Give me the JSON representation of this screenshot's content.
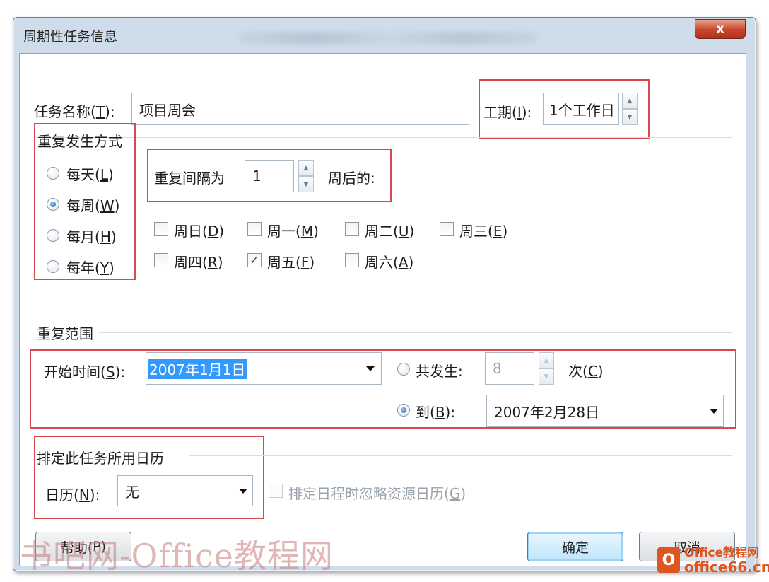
{
  "window": {
    "title": "周期性任务信息",
    "close_label": "x"
  },
  "task": {
    "name_label": "任务名称(T):",
    "name_label_main": "任务名称(",
    "name_label_key": "T",
    "name_label_end": "):",
    "name_value": "项目周会",
    "duration_label_main": "工期(",
    "duration_label_key": "I",
    "duration_label_end": "):",
    "duration_value": "1个工作日"
  },
  "recurrence": {
    "group_title": "重复发生方式",
    "options": [
      {
        "main": "每天(",
        "key": "L",
        "end": ")",
        "selected": false
      },
      {
        "main": "每周(",
        "key": "W",
        "end": ")",
        "selected": true
      },
      {
        "main": "每月(",
        "key": "H",
        "end": ")",
        "selected": false
      },
      {
        "main": "每年(",
        "key": "Y",
        "end": ")",
        "selected": false
      }
    ],
    "interval_label": "重复间隔为",
    "interval_value": "1",
    "interval_suffix": "周后的:",
    "days": [
      {
        "main": "周日(",
        "key": "D",
        "end": ")",
        "checked": false
      },
      {
        "main": "周一(",
        "key": "M",
        "end": ")",
        "checked": false
      },
      {
        "main": "周二(",
        "key": "U",
        "end": ")",
        "checked": false
      },
      {
        "main": "周三(",
        "key": "E",
        "end": ")",
        "checked": false
      },
      {
        "main": "周四(",
        "key": "R",
        "end": ")",
        "checked": false
      },
      {
        "main": "周五(",
        "key": "F",
        "end": ")",
        "checked": true
      },
      {
        "main": "周六(",
        "key": "A",
        "end": ")",
        "checked": false
      }
    ]
  },
  "range": {
    "group_title": "重复范围",
    "start_label_main": "开始时间(",
    "start_label_key": "S",
    "start_label_end": "):",
    "start_value": "2007年1月1日",
    "occur_label_main": "共发生:",
    "occur_value": "8",
    "occur_suffix_main": "次(",
    "occur_suffix_key": "C",
    "occur_suffix_end": ")",
    "occur_selected": false,
    "end_label_main": "到(",
    "end_label_key": "B",
    "end_label_end": "):",
    "end_selected": true,
    "end_value": "2007年2月28日"
  },
  "calendar": {
    "group_title": "排定此任务所用日历",
    "label_main": "日历(",
    "label_key": "N",
    "label_end": "):",
    "value": "无",
    "ignore_main": "排定日程时忽略资源日历(",
    "ignore_key": "G",
    "ignore_end": ")"
  },
  "buttons": {
    "help_main": "帮助(",
    "help_key": "P",
    "help_end": ")",
    "ok": "确定",
    "cancel": "取消"
  },
  "watermark": {
    "text": "书吧网-Office教程网",
    "brand_top": "Office教程网",
    "brand_bottom": "office66.cn",
    "brand_logo": "O"
  },
  "colors": {
    "highlight": "#d9484e",
    "selection": "#3399ff",
    "frame": "#cfdcea"
  }
}
